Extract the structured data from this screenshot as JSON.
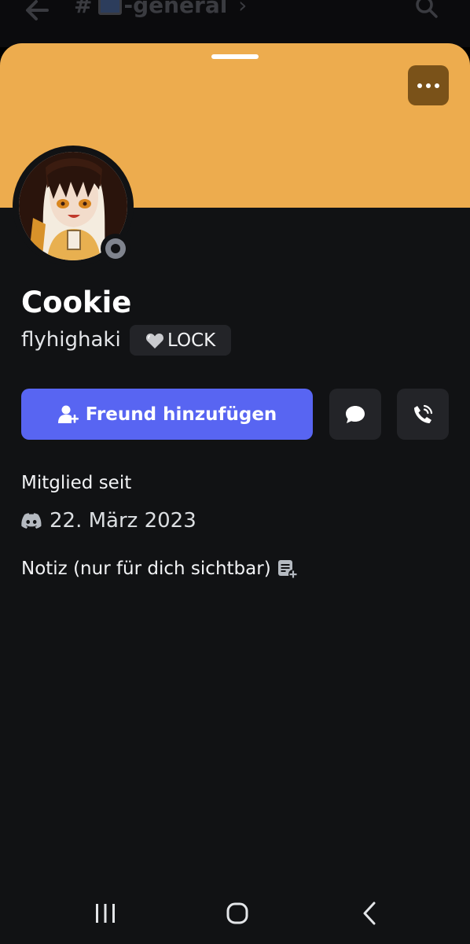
{
  "background_header": {
    "channel_hash": "#",
    "channel_name": "-general",
    "chevron": "›"
  },
  "profile": {
    "display_name": "Cookie",
    "username": "flyhighaki",
    "tag_label": "LOCK",
    "status": "offline"
  },
  "actions": {
    "add_friend_label": "Freund hinzufügen"
  },
  "membership": {
    "label": "Mitglied seit",
    "date": "22. März 2023"
  },
  "note": {
    "label": "Notiz (nur für dich sichtbar)"
  },
  "colors": {
    "banner": "#edac4e",
    "accent": "#5865f2",
    "sheet_background": "#111214",
    "button_background": "#232428"
  },
  "icons": {
    "back": "arrow-left-icon",
    "search": "search-icon",
    "more": "more-dots-icon",
    "add_friend": "add-friend-icon",
    "message": "message-bubble-icon",
    "call": "phone-call-icon",
    "member_since": "discord-logo-icon",
    "note": "note-add-icon",
    "recents": "recents-icon",
    "home": "home-icon",
    "nav_back": "nav-back-icon"
  }
}
